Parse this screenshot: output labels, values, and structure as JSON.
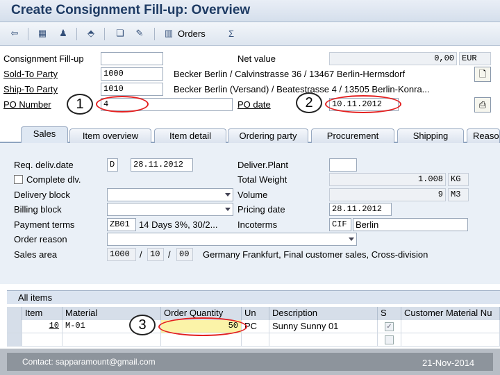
{
  "window": {
    "title": "Create Consignment Fill-up: Overview"
  },
  "toolbar": {
    "orders_label": "Orders"
  },
  "header": {
    "consignment_fillup": {
      "label": "Consignment Fill-up",
      "value": ""
    },
    "net_value": {
      "label": "Net value",
      "value": "0,00",
      "currency": "EUR"
    },
    "sold_to": {
      "label": "Sold-To Party",
      "value": "1000",
      "desc": "Becker Berlin / Calvinstrasse 36 / 13467 Berlin-Hermsdorf"
    },
    "ship_to": {
      "label": "Ship-To Party",
      "value": "1010",
      "desc": "Becker Berlin (Versand) / Beatestrasse 4 / 13505 Berlin-Konra..."
    },
    "po_number": {
      "label": "PO Number",
      "value": "4"
    },
    "po_date": {
      "label": "PO date",
      "value": "10.11.2012"
    }
  },
  "callouts": {
    "one": "1",
    "two": "2",
    "three": "3"
  },
  "tabs": [
    {
      "label": "Sales",
      "active": true
    },
    {
      "label": "Item overview"
    },
    {
      "label": "Item detail"
    },
    {
      "label": "Ordering party"
    },
    {
      "label": "Procurement"
    },
    {
      "label": "Shipping"
    },
    {
      "label": "Reaso"
    }
  ],
  "sales": {
    "req_deliv_date": {
      "label": "Req. deliv.date",
      "type": "D",
      "value": "28.11.2012"
    },
    "complete_dlv": {
      "label": "Complete dlv."
    },
    "delivery_block": {
      "label": "Delivery block",
      "value": ""
    },
    "billing_block": {
      "label": "Billing block",
      "value": ""
    },
    "payment_terms": {
      "label": "Payment terms",
      "value": "ZB01",
      "desc": "14 Days 3%, 30/2..."
    },
    "order_reason": {
      "label": "Order reason",
      "value": ""
    },
    "sales_area": {
      "label": "Sales area",
      "org": "1000",
      "channel": "10",
      "division": "00",
      "sep": "/",
      "desc": "Germany Frankfurt, Final customer sales, Cross-division"
    },
    "deliver_plant": {
      "label": "Deliver.Plant",
      "value": ""
    },
    "total_weight": {
      "label": "Total Weight",
      "value": "1.008",
      "unit": "KG"
    },
    "volume": {
      "label": "Volume",
      "value": "9",
      "unit": "M3"
    },
    "pricing_date": {
      "label": "Pricing date",
      "value": "28.11.2012"
    },
    "incoterms": {
      "label": "Incoterms",
      "code": "CIF",
      "place": "Berlin"
    }
  },
  "items": {
    "title": "All items",
    "columns": [
      "Item",
      "Material",
      "Order Quantity",
      "Un",
      "Description",
      "S",
      "Customer Material Nu"
    ],
    "rows": [
      {
        "item": "10",
        "material": "M-01",
        "qty": "50",
        "unit": "PC",
        "description": "Sunny Sunny 01"
      }
    ]
  },
  "footer": {
    "contact": "Contact: sapparamount@gmail.com",
    "date": "21-Nov-2014"
  },
  "colors": {
    "highlight": "#e32020",
    "accent": "#1d3a63"
  }
}
